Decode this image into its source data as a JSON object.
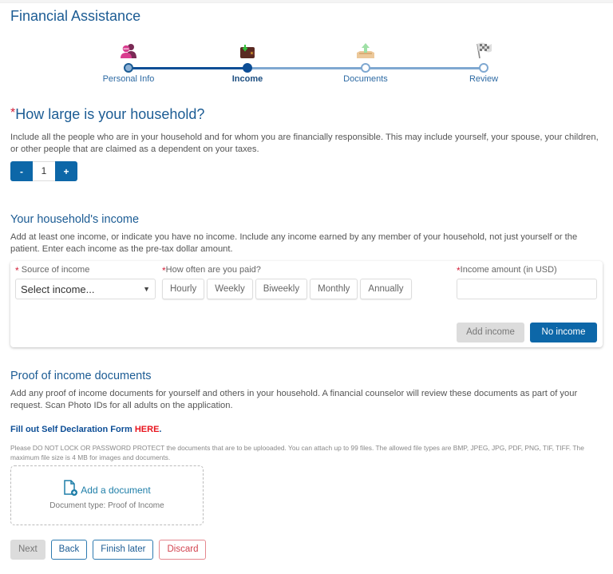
{
  "page": {
    "title": "Financial Assistance"
  },
  "steps": [
    {
      "label": "Personal Info",
      "state": "complete",
      "icon": "people-icon"
    },
    {
      "label": "Income",
      "state": "current",
      "icon": "wallet-icon"
    },
    {
      "label": "Documents",
      "state": "pending",
      "icon": "upload-tray-icon"
    },
    {
      "label": "Review",
      "state": "pending",
      "icon": "checkered-flag-icon"
    }
  ],
  "household": {
    "required_mark": "*",
    "title": "How large is your household?",
    "description": "Include all the people who are in your household and for whom you are financially responsible. This may include yourself, your spouse, your children, or other people that are claimed as a dependent on your taxes.",
    "minus_label": "-",
    "plus_label": "+",
    "count": "1"
  },
  "income": {
    "title": "Your household's income",
    "description": "Add at least one income, or indicate you have no income. Include any income earned by any member of your household, not just yourself or the patient. Enter each income as the pre-tax dollar amount.",
    "source_label": "Source of income",
    "source_value": "Select income...",
    "frequency_label": "How often are you paid?",
    "frequency_options": [
      "Hourly",
      "Weekly",
      "Biweekly",
      "Monthly",
      "Annually"
    ],
    "amount_label": "Income amount (in USD)",
    "amount_value": "",
    "add_income_label": "Add income",
    "no_income_label": "No income"
  },
  "proof": {
    "title": "Proof of income documents",
    "description": "Add any proof of income documents for yourself and others in your household. A financial counselor will review these documents as part of your request. Scan Photo IDs for all adults on the application.",
    "self_decl_prefix": "Fill out Self Declaration Form ",
    "self_decl_link": "HERE",
    "self_decl_suffix": ".",
    "fineprint": "Please DO NOT LOCK OR PASSWORD PROTECT the documents that are to be uplooaded. You can attach up to 99 files. The allowed file types are BMP, JPEG, JPG, PDF, PNG, TIF, TIFF. The maximum file size is 4 MB for images and documents.",
    "add_document_label": "Add a document",
    "document_type": "Document type: Proof of Income"
  },
  "actions": {
    "next": "Next",
    "back": "Back",
    "finish_later": "Finish later",
    "discard": "Discard"
  },
  "colors": {
    "brand_blue": "#0d67a8",
    "title_blue": "#1c5c94",
    "required_red": "#d3213a",
    "discard_red": "#d2434f",
    "here_red": "#e8141e"
  }
}
